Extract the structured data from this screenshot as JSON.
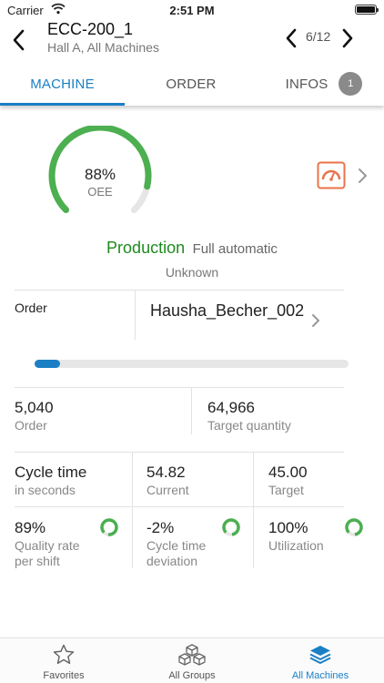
{
  "status_bar": {
    "carrier": "Carrier",
    "time": "2:51 PM",
    "icons": [
      "wifi-icon",
      "battery-icon"
    ]
  },
  "nav": {
    "title": "ECC-200_1",
    "subtitle": "Hall A, All Machines",
    "counter": "6/12",
    "icons": [
      "back-chevron-icon",
      "prev-chevron-icon",
      "next-chevron-icon"
    ]
  },
  "tabs": [
    {
      "label": "MACHINE",
      "active": true
    },
    {
      "label": "ORDER",
      "active": false
    },
    {
      "label": "INFOS",
      "active": false,
      "badge": "1"
    }
  ],
  "colors": {
    "accent": "#1a7fc4",
    "good": "#4caf50",
    "production": "#1f8a1f",
    "alert": "#e8734a"
  },
  "oee": {
    "value": "88%",
    "label": "OEE",
    "fraction": 0.88
  },
  "state": {
    "main": "Production",
    "mode": "Full automatic",
    "sub": "Unknown"
  },
  "order": {
    "label": "Order",
    "value": "Hausha_Becher_002",
    "progress": 0.08
  },
  "quantities": {
    "order_value": "5,040",
    "order_label": "Order",
    "target_value": "64,966",
    "target_label": "Target quantity"
  },
  "cycle": {
    "title": "Cycle time",
    "unit": "in seconds",
    "current_value": "54.82",
    "current_label": "Current",
    "target_value": "45.00",
    "target_label": "Target"
  },
  "kpis": [
    {
      "value": "89%",
      "label_line1": "Quality rate",
      "label_line2": "per shift",
      "fraction": 0.89
    },
    {
      "value": "-2%",
      "label_line1": "Cycle time",
      "label_line2": "deviation",
      "fraction": 0.85
    },
    {
      "value": "100%",
      "label_line1": "Utilization",
      "label_line2": "",
      "fraction": 0.85
    }
  ],
  "bottom_tabs": [
    {
      "label": "Favorites",
      "icon": "star-icon",
      "active": false
    },
    {
      "label": "All Groups",
      "icon": "cubes-icon",
      "active": false
    },
    {
      "label": "All Machines",
      "icon": "layers-icon",
      "active": true
    }
  ]
}
